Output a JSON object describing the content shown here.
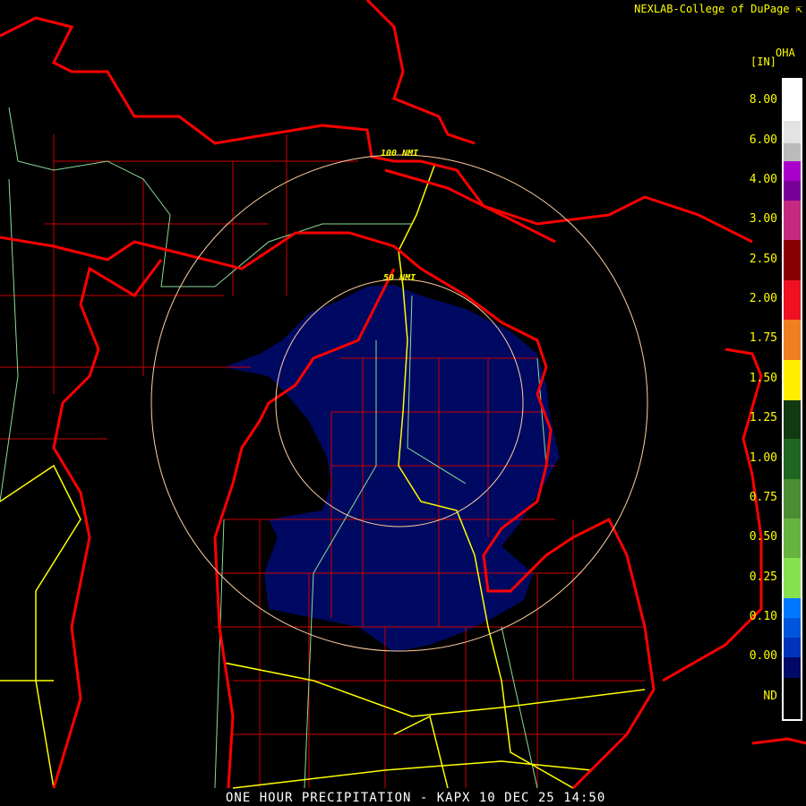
{
  "credit": "NEXLAB-College of DuPage",
  "product_code": "OHA",
  "unit": "[IN]",
  "title": "ONE HOUR PRECIPITATION - KAPX 10 DEC 25 14:50",
  "range_rings": [
    "100 NMI",
    "50 NMI"
  ],
  "legend": {
    "labels": [
      "8.00",
      "6.00",
      "4.00",
      "3.00",
      "2.50",
      "2.00",
      "1.75",
      "1.50",
      "1.25",
      "1.00",
      "0.75",
      "0.50",
      "0.25",
      "0.10",
      "0.00",
      "ND"
    ],
    "colors": [
      "#ffffff",
      "#e3e3e3",
      "#bbbbbb",
      "#aa00cc",
      "#770099",
      "#c62a80",
      "#880000",
      "#ee1122",
      "#ee8022",
      "#ffee00",
      "#123a12",
      "#1f6622",
      "#4a8d33",
      "#67b340",
      "#87e050",
      "#0077ff",
      "#0055dd",
      "#0033bb",
      "#000a66",
      "#000000"
    ]
  },
  "colors": {
    "coast": "#ff0000",
    "county": "#cc0000",
    "highway": "#ffff00",
    "road": "#88dd99",
    "precip": "#000a66",
    "ring": "#ffd0a0"
  }
}
